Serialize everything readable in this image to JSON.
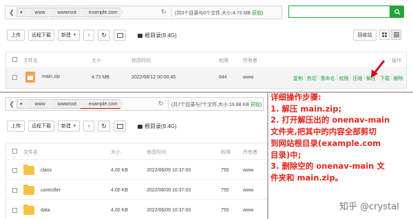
{
  "top": {
    "crumbs": [
      "www",
      "wwwroot",
      "example.com"
    ],
    "info": "(共0个目录与0个文件,大小:4.73 MB ",
    "info_link": "获取",
    "info_close": ")",
    "toolbar": {
      "upload": "上传",
      "remote_download": "远程下载",
      "new": "新建",
      "root_dir": "根目录(9.4G)",
      "recycle": "回收站"
    },
    "columns": {
      "name": "文件名",
      "size": "大小",
      "modified": "修改时间",
      "perm": "权限",
      "owner": "所有者",
      "ops": "操作"
    },
    "row": {
      "name": "main.zip",
      "size": "4.73 MB",
      "modified": "2022/06/12 00:00:45",
      "perm": "644",
      "owner": "www"
    },
    "ops": [
      "复制",
      "剪切",
      "重命名",
      "权限",
      "压缩",
      "解压",
      "下载",
      "删除"
    ]
  },
  "bottom": {
    "crumbs": [
      "www",
      "wwwroot",
      "example.com"
    ],
    "info": "(共7个目录与7个文件,大小:19.88 KB ",
    "info_link": "获取",
    "info_close": ")",
    "toolbar": {
      "upload": "上传",
      "remote_download": "远程下载",
      "new": "新建",
      "root_dir": "根目录(9.4G)"
    },
    "columns": {
      "name": "文件名",
      "size": "大小",
      "modified": "修改时间",
      "perm": "权限",
      "owner": "所有者"
    },
    "rows": [
      {
        "name": "class",
        "size": "4.00 KB",
        "modified": "2022/06/09 10:37:03",
        "perm": "755",
        "owner": "www"
      },
      {
        "name": "controller",
        "size": "4.00 KB",
        "modified": "2022/06/09 10:37:03",
        "perm": "755",
        "owner": "www"
      },
      {
        "name": "data",
        "size": "4.00 KB",
        "modified": "2022/06/09 10:37:03",
        "perm": "755",
        "owner": "www"
      }
    ]
  },
  "note": {
    "lines": [
      "详细操作步骤:",
      "1. 解压 main.zip;",
      "2. 打开解压出的 onenav-main",
      "文件夹,把其中的内容全部剪切",
      "到网站根目录(example.com",
      "目录)中;",
      "3. 删除空的 onenav-main 文",
      "件夹和 main.zip。"
    ]
  },
  "watermark": "知乎 @crystal",
  "colors": {
    "accent": "#20a53a",
    "annotation": "#e8231a",
    "arrow": "#d0021b"
  },
  "icons": [
    "back-icon",
    "up-icon",
    "refresh-icon",
    "search-icon",
    "folder-icon",
    "zip-file-icon",
    "disk-icon",
    "grid-view-icon",
    "list-view-icon"
  ]
}
